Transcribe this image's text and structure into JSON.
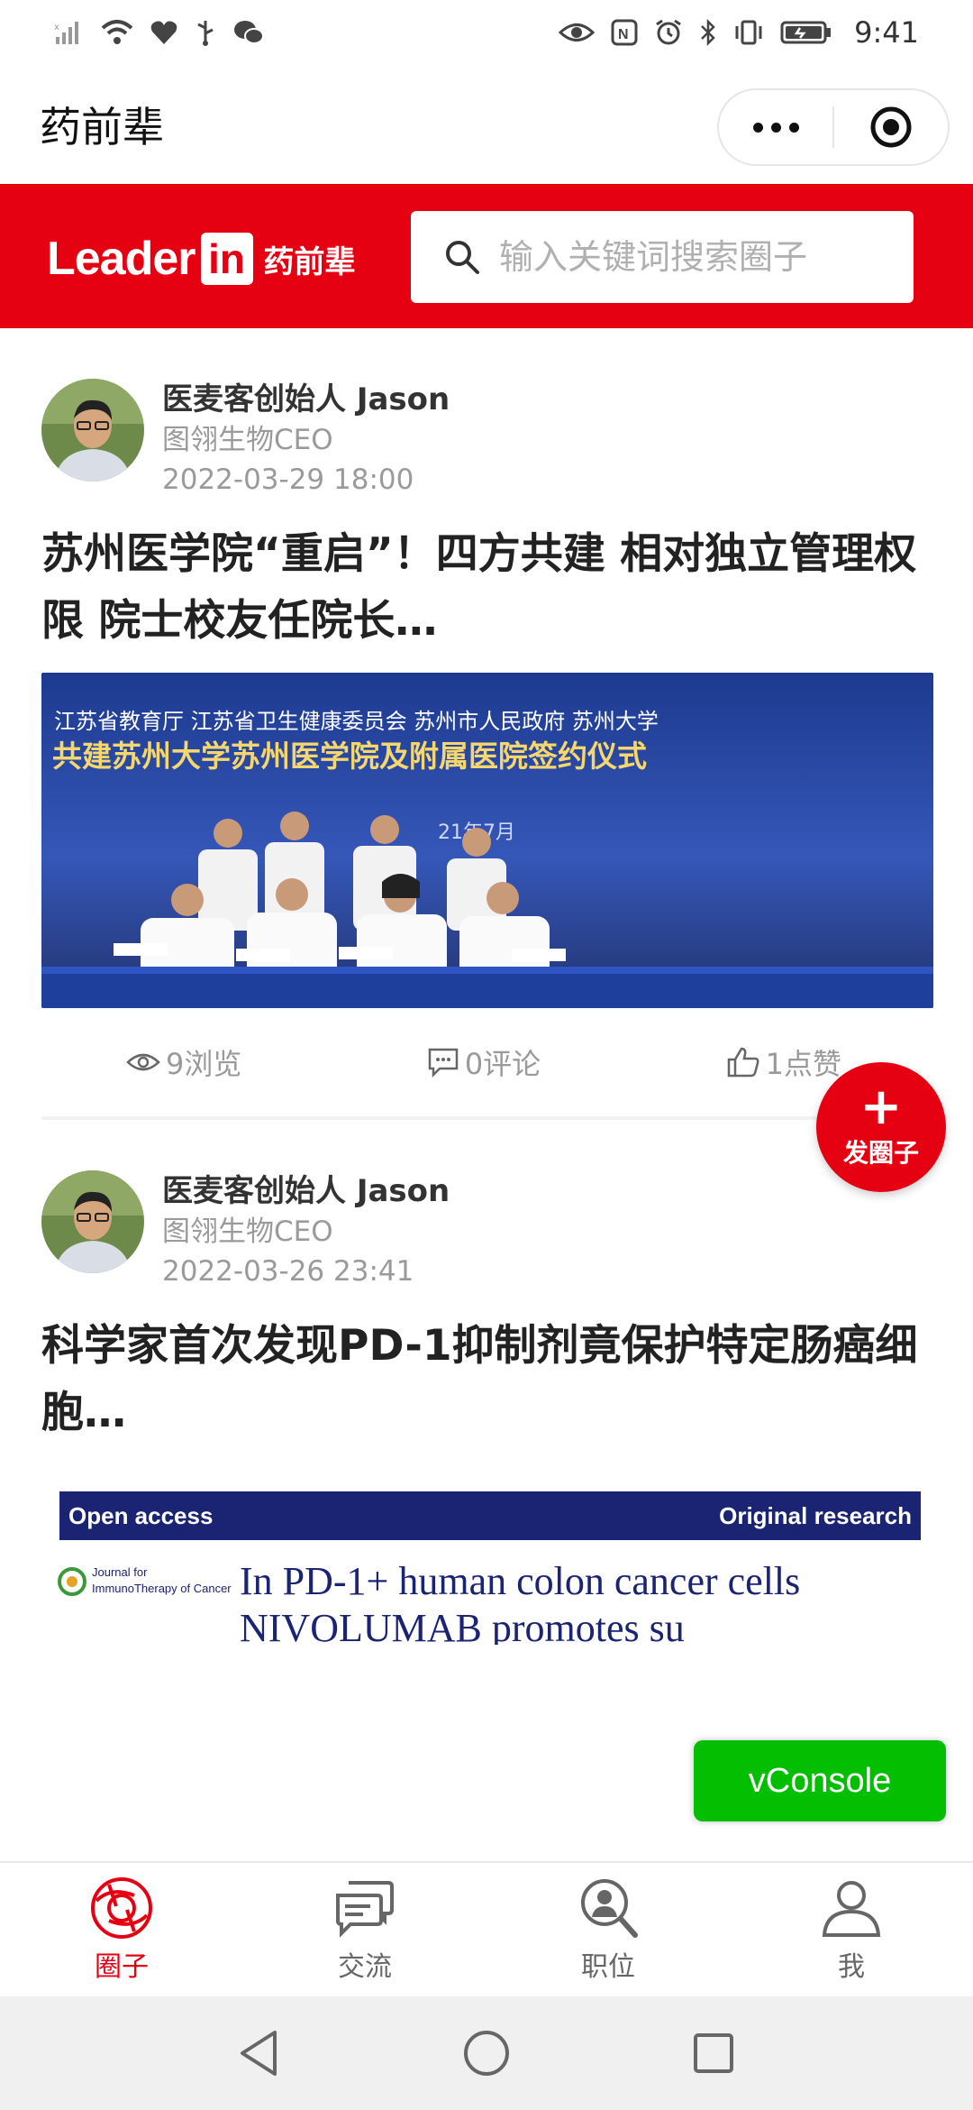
{
  "status_bar": {
    "time": "9:41",
    "left_icons": [
      "signal-icon",
      "wifi-icon",
      "health-icon",
      "usb-icon",
      "wechat-icon"
    ],
    "right_icons": [
      "eye-icon",
      "nfc-icon",
      "alarm-icon",
      "bluetooth-icon",
      "vibrate-icon",
      "battery-icon"
    ]
  },
  "header": {
    "title": "药前辈",
    "capsule": {
      "more_icon": "more-dots-icon",
      "close_icon": "target-close-icon"
    }
  },
  "brand": {
    "logo_text": "Leader",
    "logo_in": "in",
    "logo_cn": "药前辈",
    "search_placeholder": "输入关键词搜索圈子",
    "accent_color": "#e50012"
  },
  "posts": [
    {
      "author": "医麦客创始人 Jason",
      "company": "图翎生物CEO",
      "time": "2022-03-29 18:00",
      "title": "苏州医学院“重启”！四方共建 相对独立管理权限 院士校友任院长…",
      "image": {
        "banner_line1": "江苏省教育厅   江苏省卫生健康委员会   苏州市人民政府   苏州大学",
        "banner_line2": "共建苏州大学苏州医学院及附属医院签约仪式",
        "banner_date": "21年7月"
      },
      "views": "9浏览",
      "comments": "0评论",
      "likes": "1点赞"
    },
    {
      "author": "医麦客创始人 Jason",
      "company": "图翎生物CEO",
      "time": "2022-03-26 23:41",
      "title": "科学家首次发现PD-1抑制剂竟保护特定肠癌细胞…",
      "image": {
        "bar_left": "Open access",
        "bar_right": "Original research",
        "journal": "Journal for ImmunoTherapy of Cancer",
        "headline1": "In PD-1+ human colon cancer cells",
        "headline2": "NIVOLUMAB promotes su"
      }
    }
  ],
  "fab": {
    "plus": "+",
    "label": "发圈子"
  },
  "vconsole": "vConsole",
  "tabbar": [
    {
      "label": "圈子",
      "icon": "circle-aperture-icon",
      "active": true
    },
    {
      "label": "交流",
      "icon": "chat-bubbles-icon",
      "active": false
    },
    {
      "label": "职位",
      "icon": "job-search-icon",
      "active": false
    },
    {
      "label": "我",
      "icon": "person-icon",
      "active": false
    }
  ],
  "system_nav": [
    "back-icon",
    "home-icon",
    "recents-icon"
  ]
}
